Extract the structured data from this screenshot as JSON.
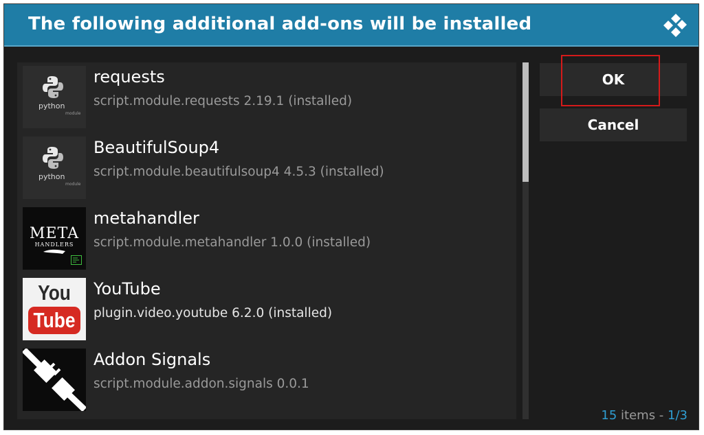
{
  "dialog": {
    "title": "The following additional add-ons will be installed",
    "logo_icon": "kodi-logo-icon"
  },
  "addons": [
    {
      "name": "requests",
      "subtitle": "script.module.requests 2.19.1 (installed)",
      "icon": "python-module-icon",
      "icon_text": "python",
      "icon_subtext": "module"
    },
    {
      "name": "BeautifulSoup4",
      "subtitle": "script.module.beautifulsoup4 4.5.3 (installed)",
      "icon": "python-module-icon",
      "icon_text": "python",
      "icon_subtext": "module"
    },
    {
      "name": "metahandler",
      "subtitle": "script.module.metahandler 1.0.0 (installed)",
      "icon": "metahandlers-logo",
      "icon_text": "META",
      "icon_subtext": "HANDLERS"
    },
    {
      "name": "YouTube",
      "subtitle": "plugin.video.youtube 6.2.0 (installed)",
      "icon": "youtube-logo",
      "icon_text": "You",
      "icon_subtext": "Tube"
    },
    {
      "name": "Addon Signals",
      "subtitle": "script.module.addon.signals 0.0.1",
      "icon": "plug-icon"
    }
  ],
  "buttons": {
    "ok": "OK",
    "cancel": "Cancel"
  },
  "footer": {
    "count": "15",
    "items_label": " items - ",
    "page": "1/3"
  },
  "colors": {
    "titlebar": "#1f7da6",
    "background": "#1c1c1c",
    "panel": "#252525",
    "accent": "#2f9ed3",
    "highlight_box": "#d61a1a"
  }
}
